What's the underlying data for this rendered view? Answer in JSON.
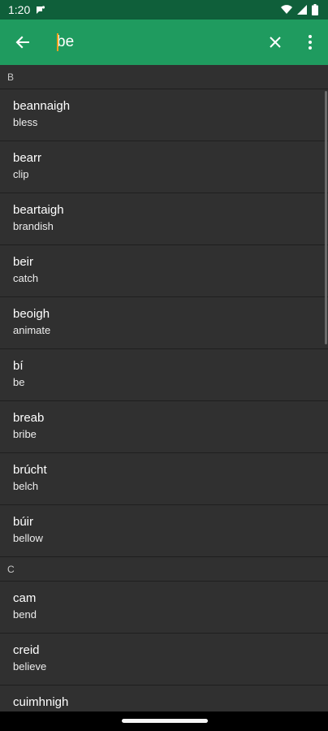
{
  "status": {
    "time": "1:20"
  },
  "search": {
    "value": "be",
    "placeholder": ""
  },
  "sections": [
    {
      "letter": "B",
      "entries": [
        {
          "word": "beannaigh",
          "translation": "bless"
        },
        {
          "word": "bearr",
          "translation": "clip"
        },
        {
          "word": "beartaigh",
          "translation": "brandish"
        },
        {
          "word": "beir",
          "translation": "catch"
        },
        {
          "word": "beoigh",
          "translation": "animate"
        },
        {
          "word": "bí",
          "translation": "be"
        },
        {
          "word": "breab",
          "translation": "bribe"
        },
        {
          "word": "brúcht",
          "translation": "belch"
        },
        {
          "word": "búir",
          "translation": "bellow"
        }
      ]
    },
    {
      "letter": "C",
      "entries": [
        {
          "word": "cam",
          "translation": "bend"
        },
        {
          "word": "creid",
          "translation": "believe"
        },
        {
          "word": "cuimhnigh",
          "translation": ""
        }
      ]
    }
  ],
  "icons": {
    "back": "arrow-back-icon",
    "clear": "close-icon",
    "more": "more-vert-icon"
  },
  "colors": {
    "app_bar": "#1f9b5f",
    "status_bar": "#0f5f3a",
    "background": "#303030",
    "cursor": "#f0a020"
  }
}
